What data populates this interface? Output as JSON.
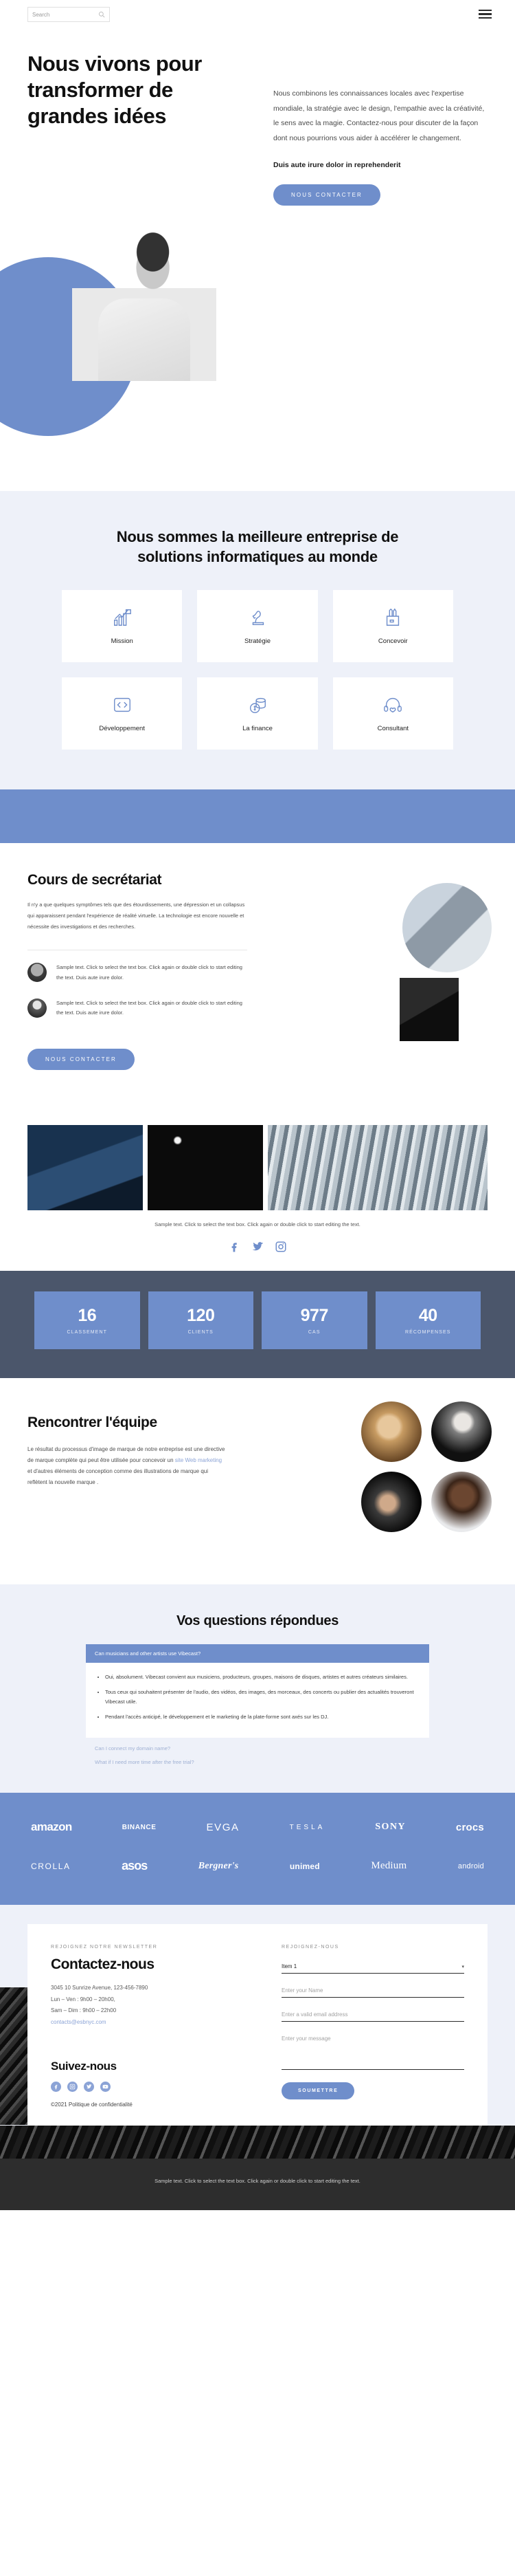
{
  "header": {
    "search_placeholder": "Search",
    "search_icon": "search-icon",
    "menu_icon": "hamburger-menu-icon"
  },
  "hero": {
    "title": "Nous vivons pour transformer de grandes idées",
    "paragraph": "Nous combinons les connaissances locales avec l'expertise mondiale, la stratégie avec le design, l'empathie avec la créativité, le sens avec la magie. Contactez-nous pour discuter de la façon dont nous pourrions vous aider à accélérer le changement.",
    "bold_line": "Duis aute irure dolor in reprehenderit",
    "cta": "NOUS CONTACTER"
  },
  "services": {
    "title": "Nous sommes la meilleure entreprise de solutions informatiques au monde",
    "cards": [
      {
        "label": "Mission",
        "icon": "growth-chart-flag-icon"
      },
      {
        "label": "Stratégie",
        "icon": "chess-knight-icon"
      },
      {
        "label": "Concevoir",
        "icon": "pencil-cup-icon"
      },
      {
        "label": "Développement",
        "icon": "code-brackets-icon"
      },
      {
        "label": "La finance",
        "icon": "coins-stack-icon"
      },
      {
        "label": "Consultant",
        "icon": "headset-support-icon"
      }
    ]
  },
  "secretariat": {
    "title": "Cours de secrétariat",
    "paragraph": "Il n'y a que quelques symptômes tels que des étourdissements, une dépression et un collapsus qui apparaissent pendant l'expérience de réalité virtuelle. La technologie est encore nouvelle et nécessite des investigations et des recherches.",
    "testimonials": [
      {
        "text": "Sample text. Click to select the text box. Click again or double click to start editing the text. Duis aute irure dolor.",
        "avatar": "avatar-man"
      },
      {
        "text": "Sample text. Click to select the text box. Click again or double click to start editing the text. Duis aute irure dolor.",
        "avatar": "avatar-woman"
      }
    ],
    "cta": "NOUS CONTACTER"
  },
  "gallery": {
    "caption": "Sample text. Click to select the text box. Click again or double click to start editing the text.",
    "socials": [
      "facebook-icon",
      "twitter-icon",
      "instagram-icon"
    ]
  },
  "stats": [
    {
      "number": "16",
      "label": "CLASSEMENT"
    },
    {
      "number": "120",
      "label": "CLIENTS"
    },
    {
      "number": "977",
      "label": "CAS"
    },
    {
      "number": "40",
      "label": "RÉCOMPENSES"
    }
  ],
  "team": {
    "title": "Rencontrer l'équipe",
    "para_before": "Le résultat du processus d'image de marque de notre entreprise est une directive de marque complète qui peut être utilisée pour concevoir un ",
    "link": "site Web marketing",
    "para_after": " et d'autres éléments de conception comme des illustrations de marque qui reflètent la nouvelle marque ."
  },
  "faq": {
    "title": "Vos questions répondues",
    "open_question": "Can musicians and other artists use Vibecast?",
    "answers": [
      "Oui, absolument. Vibecast convient aux musiciens, producteurs, groupes, maisons de disques, artistes et autres créateurs similaires.",
      "Tous ceux qui souhaitent présenter de l'audio, des vidéos, des images, des morceaux, des concerts ou publier des actualités trouveront Vibecast utile.",
      "Pendant l'accès anticipé, le développement et le marketing de la plate-forme sont axés sur les DJ."
    ],
    "closed_questions": [
      "Can I connect my domain name?",
      "What if I need more time after the free trial?"
    ]
  },
  "brands": {
    "row1": [
      "amazon",
      "BINANCE",
      "EVGA",
      "TESLA",
      "SONY",
      "crocs"
    ],
    "row2": [
      "CROLLA",
      "asos",
      "Bergner's",
      "unimed",
      "Medium",
      "android"
    ]
  },
  "contact": {
    "eyebrow_left": "REJOIGNEZ NOTRE NEWSLETTER",
    "title": "Contactez-nous",
    "address_line1": "3045 10 Sunrize Avenue, 123-456-7890",
    "address_line2": "Lun – Ven : 9h00 – 20h00,",
    "address_line3": "Sam – Dim : 9h00 – 22h00",
    "email": "contacts@esbnyc.com",
    "follow_title": "Suivez-nous",
    "socials": [
      "facebook-icon",
      "instagram-icon",
      "twitter-icon",
      "youtube-icon"
    ],
    "copyright": "©2021 Politique de confidentialité",
    "eyebrow_right": "REJOIGNEZ-NOUS",
    "select_value": "Item 1",
    "caret": "▾",
    "name_placeholder": "Enter your Name",
    "email_placeholder": "Enter a valid email address",
    "message_placeholder": "Enter your message",
    "submit": "SOUMETTRE"
  },
  "footer": {
    "text": "Sample text. Click to select the text box. Click again or double click to start editing the text."
  }
}
